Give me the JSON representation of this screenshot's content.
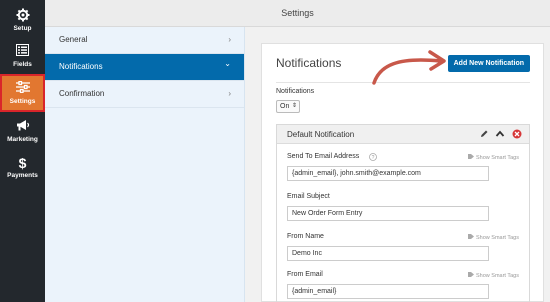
{
  "rail": {
    "items": [
      {
        "label": "Setup",
        "icon": "gear-icon"
      },
      {
        "label": "Fields",
        "icon": "list-icon"
      },
      {
        "label": "Settings",
        "icon": "sliders-icon"
      },
      {
        "label": "Marketing",
        "icon": "megaphone-icon"
      },
      {
        "label": "Payments",
        "icon": "dollar-icon"
      }
    ]
  },
  "header": {
    "title": "Settings"
  },
  "subnav": {
    "items": [
      {
        "label": "General",
        "chevron": "›"
      },
      {
        "label": "Notifications",
        "chevron": "⌄"
      },
      {
        "label": "Confirmation",
        "chevron": "›"
      }
    ]
  },
  "panel": {
    "title": "Notifications",
    "add_button": "Add New Notification",
    "notifications_label": "Notifications",
    "notifications_value": "On",
    "default_notification": {
      "title": "Default Notification",
      "smart_tags_label": "Show Smart Tags",
      "fields": [
        {
          "label": "Send To Email Address",
          "value": "{admin_email}, john.smith@example.com",
          "has_help": true,
          "has_smart_tags": true
        },
        {
          "label": "Email Subject",
          "value": "New Order Form Entry",
          "has_help": false,
          "has_smart_tags": false
        },
        {
          "label": "From Name",
          "value": "Demo Inc",
          "has_help": false,
          "has_smart_tags": true
        },
        {
          "label": "From Email",
          "value": "{admin_email}",
          "has_help": false,
          "has_smart_tags": true
        }
      ]
    }
  },
  "colors": {
    "rail_bg": "#23282d",
    "accent_orange": "#e27730",
    "highlight_red": "#d9252a",
    "primary_blue": "#036aab",
    "subnav_bg": "#ebf3fb",
    "arrow_red": "#c8584a"
  }
}
